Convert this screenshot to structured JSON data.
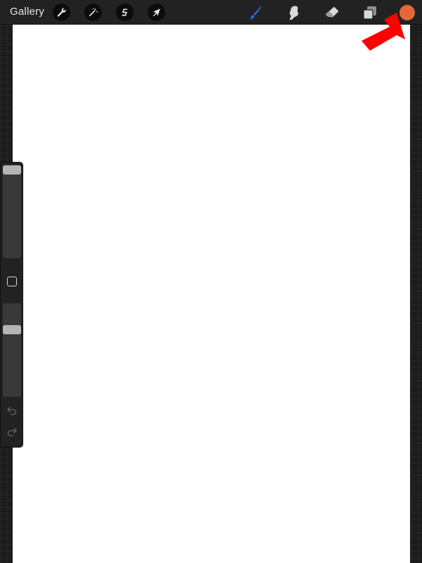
{
  "topbar": {
    "gallery_label": "Gallery",
    "tools_left": [
      {
        "name": "actions",
        "icon": "wrench-icon"
      },
      {
        "name": "adjustments",
        "icon": "magic-wand-icon"
      },
      {
        "name": "selection",
        "icon": "selection-s-icon"
      },
      {
        "name": "transform",
        "icon": "cursor-arrow-icon"
      }
    ],
    "tools_right": [
      {
        "name": "brush",
        "icon": "brush-icon",
        "active": true,
        "color": "#1e7bff"
      },
      {
        "name": "smudge",
        "icon": "smudge-finger-icon",
        "active": false,
        "color": "#d9d9d9"
      },
      {
        "name": "eraser",
        "icon": "eraser-icon",
        "active": false,
        "color": "#d9d9d9"
      },
      {
        "name": "layers",
        "icon": "layers-icon",
        "active": false,
        "color": "#d9d9d9"
      }
    ],
    "current_color": "#e8673a"
  },
  "canvas": {
    "background": "#ffffff"
  },
  "sidebar": {
    "brush_size_level": 1.0,
    "opacity_level": 0.75,
    "modify_icon": "square-modify-icon",
    "undo_icon": "undo-arrow-icon",
    "redo_icon": "redo-arrow-icon"
  },
  "annotation": {
    "arrow_color": "#ff0000",
    "arrow_icon": "red-pointer-arrow"
  }
}
